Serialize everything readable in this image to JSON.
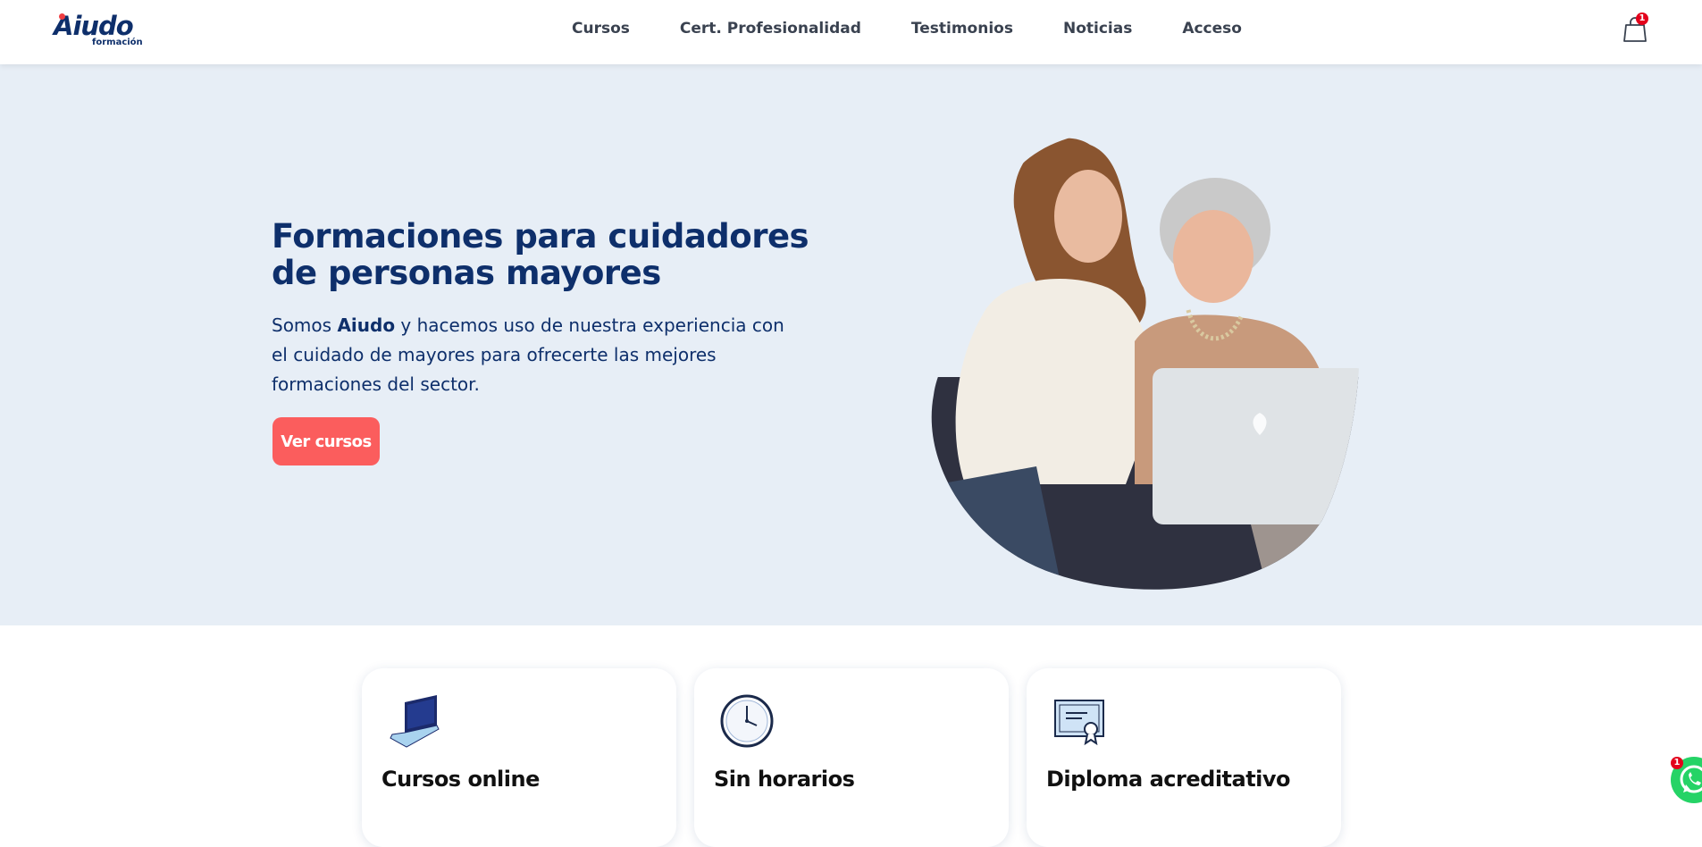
{
  "brand": {
    "name": "Aiudo",
    "sub": "formación"
  },
  "nav": [
    {
      "label": "Cursos"
    },
    {
      "label": "Cert. Profesionalidad"
    },
    {
      "label": "Testimonios"
    },
    {
      "label": "Noticias"
    },
    {
      "label": "Acceso"
    }
  ],
  "cart": {
    "count": "1",
    "icon": "shopping-bag-icon"
  },
  "hero": {
    "title": "Formaciones para cuidadores de personas mayores",
    "text_before": "Somos ",
    "brand_bold": "Aiudo",
    "text_after": " y hacemos uso de nuestra experiencia con el cuidado de mayores para ofrecerte las mejores formaciones del sector.",
    "cta": "Ver cursos"
  },
  "features": [
    {
      "title": "Cursos online",
      "icon": "laptop-icon",
      "desc": ""
    },
    {
      "title": "Sin horarios",
      "icon": "clock-icon",
      "desc": ""
    },
    {
      "title": "Diploma acreditativo",
      "icon": "certificate-icon",
      "desc": ""
    }
  ],
  "whatsapp": {
    "count": "1",
    "icon": "whatsapp-icon"
  },
  "colors": {
    "primary": "#0e2f6b",
    "accent": "#fb5d5d",
    "hero_bg": "#e7eef6",
    "whatsapp": "#25d366"
  }
}
